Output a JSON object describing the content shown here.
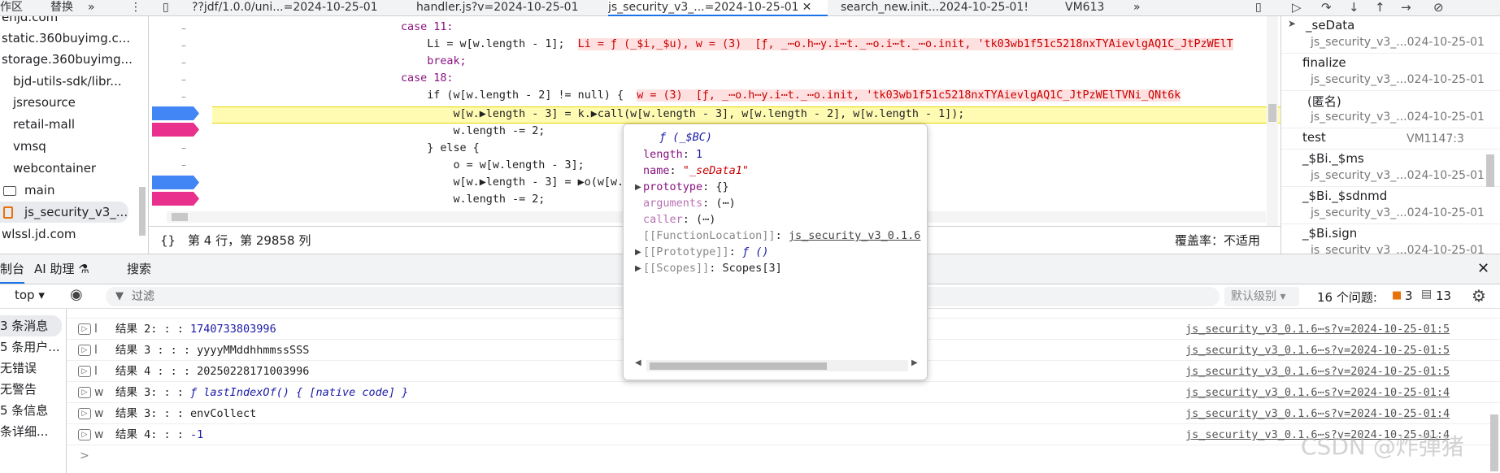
{
  "tabbar": {
    "left_items": [
      "作区",
      "替换"
    ],
    "tabs": [
      {
        "label": "??jdf/1.0.0/uni...=2024-10-25-01",
        "active": false
      },
      {
        "label": "handler.js?v=2024-10-25-01",
        "active": false
      },
      {
        "label": "js_security_v3_...=2024-10-25-01",
        "active": true
      },
      {
        "label": "search_new.init...2024-10-25-01!",
        "active": false
      },
      {
        "label": "VM613",
        "active": false
      }
    ]
  },
  "filetree": {
    "items": [
      {
        "label": "enjd.com",
        "type": "domain"
      },
      {
        "label": "static.360buyimg.c...",
        "type": "domain"
      },
      {
        "label": "storage.360buyimg...",
        "type": "domain"
      },
      {
        "label": "bjd-utils-sdk/libr...",
        "type": "folder"
      },
      {
        "label": "jsresource",
        "type": "folder"
      },
      {
        "label": "retail-mall",
        "type": "folder"
      },
      {
        "label": "vmsq",
        "type": "folder"
      },
      {
        "label": "webcontainer",
        "type": "folder"
      },
      {
        "label": "main",
        "type": "folder"
      },
      {
        "label": "js_security_v3_...",
        "type": "file",
        "selected": true
      },
      {
        "label": "wlssl.jd.com",
        "type": "domain"
      }
    ]
  },
  "editor": {
    "lines": [
      {
        "code": "case 11:",
        "inline": ""
      },
      {
        "code": "    Li = w[w.length - 1];",
        "inline": "Li = ƒ (_$i,_$u), w = (3)  [ƒ, _⋯o.h⋯y.i⋯t._⋯o.i⋯t._⋯o.init, 'tk03wb1f51c5218nxTYAievlgAQ1C_JtPzWElT"
      },
      {
        "code": "    break;",
        "inline": ""
      },
      {
        "code": "case 18:",
        "inline": ""
      },
      {
        "code": "    if (w[w.length - 2] != null) {",
        "inline": "w = (3)  [ƒ, _⋯o.h⋯y.i⋯t._⋯o.init, 'tk03wb1f51c5218nxTYAievlgAQ1C_JtPzWElTVNi_QNt6k"
      },
      {
        "code": "        w[w.▶length - 3] = k.▶call(w[w.length - 3], w[w.length - 2], w[w.length - 1]);",
        "inline": ""
      },
      {
        "code": "        w.length -= 2;",
        "inline": ""
      },
      {
        "code": "    } else {",
        "inline": ""
      },
      {
        "code": "        o = w[w.length - 3];",
        "inline": ""
      },
      {
        "code": "        w[w.▶length - 3] = ▶o(w[w.",
        "inline": ""
      },
      {
        "code": "        w.length -= 2;",
        "inline": ""
      }
    ],
    "gutter_marks": [
      "–",
      "–",
      "–",
      "–",
      "–",
      "–",
      "–",
      "–",
      "–",
      "–",
      "–"
    ]
  },
  "statusbar": {
    "braces": "{}",
    "position": "第 4 行，第 29858 列",
    "coverage": "覆盖率：不适用"
  },
  "callstack": {
    "frames": [
      {
        "name": "_seData",
        "loc": "js_security_v3_...024-10-25-01",
        "current": true
      },
      {
        "name": "finalize",
        "loc": "js_security_v3_...024-10-25-01"
      },
      {
        "name": "(匿名)",
        "loc": "js_security_v3_...024-10-25-01"
      },
      {
        "name": "test",
        "loc": "VM1147:3",
        "loc_inline": true
      },
      {
        "name": "_$Bi._$ms",
        "loc": "js_security_v3_...024-10-25-01"
      },
      {
        "name": "_$Bi._$sdnmd",
        "loc": "js_security_v3_...024-10-25-01"
      },
      {
        "name": "_$Bi.sign",
        "loc": "js_security_v3_...024-10-25-01"
      }
    ]
  },
  "drawer": {
    "tabs": [
      "制台",
      "AI 助理 ⚗",
      "搜索"
    ]
  },
  "console_toolbar": {
    "context": "top ▾",
    "filter_placeholder": "过滤",
    "level": "默认级别 ▾",
    "issues": "16 个问题:",
    "warn_count": "3",
    "info_count": "13"
  },
  "console_side": {
    "items": [
      "3 条消息",
      "5 条用户...",
      "无错误",
      "无警告",
      "5 条信息",
      "条详细..."
    ]
  },
  "console": {
    "rows": [
      {
        "level": "l",
        "text": "结果 2: : : ",
        "value": "1740733803996",
        "value_type": "num",
        "src": "js_security_v3_0.1.6⋯s?v=2024-10-25-01:5"
      },
      {
        "level": "l",
        "text": "结果 3 : : : ",
        "value": "yyyyMMddhhmmssSSS",
        "value_type": "str",
        "src": "js_security_v3_0.1.6⋯s?v=2024-10-25-01:5"
      },
      {
        "level": "l",
        "text": "结果 4 : : : ",
        "value": "20250228171003996",
        "value_type": "str",
        "src": "js_security_v3_0.1.6⋯s?v=2024-10-25-01:5"
      },
      {
        "level": "w",
        "text": "结果 3: : : ",
        "value": "ƒ lastIndexOf() { [native code] }",
        "value_type": "fn",
        "src": "js_security_v3_0.1.6⋯s?v=2024-10-25-01:4"
      },
      {
        "level": "w",
        "text": "结果 3: : : ",
        "value": "envCollect",
        "value_type": "str",
        "src": "js_security_v3_0.1.6⋯s?v=2024-10-25-01:4"
      },
      {
        "level": "w",
        "text": "结果 4: : : ",
        "value": "-1",
        "value_type": "num",
        "src": "js_security_v3_0.1.6⋯s?v=2024-10-25-01:4"
      }
    ],
    "prompt": ">"
  },
  "popover": {
    "header": "ƒ (_$BC)",
    "props": [
      {
        "key": "length",
        "value": "1",
        "kind": "num",
        "expandable": false
      },
      {
        "key": "name",
        "value": "\"_seData1\"",
        "kind": "str",
        "expandable": false
      },
      {
        "key": "prototype",
        "value": "{}",
        "kind": "plain",
        "expandable": true
      },
      {
        "key": "arguments",
        "value": "(⋯)",
        "kind": "plain",
        "expandable": false,
        "dim": true
      },
      {
        "key": "caller",
        "value": "(⋯)",
        "kind": "plain",
        "expandable": false,
        "dim": true
      },
      {
        "key": "[[FunctionLocation]]",
        "value": "js_security_v3_0.1.6",
        "kind": "link",
        "expandable": false,
        "dim": true
      },
      {
        "key": "[[Prototype]]",
        "value": "ƒ ()",
        "kind": "fn",
        "expandable": true,
        "dim": true
      },
      {
        "key": "[[Scopes]]",
        "value": "Scopes[3]",
        "kind": "plain",
        "expandable": true,
        "dim": true
      }
    ]
  },
  "watermark": "CSDN @炸弹猪"
}
